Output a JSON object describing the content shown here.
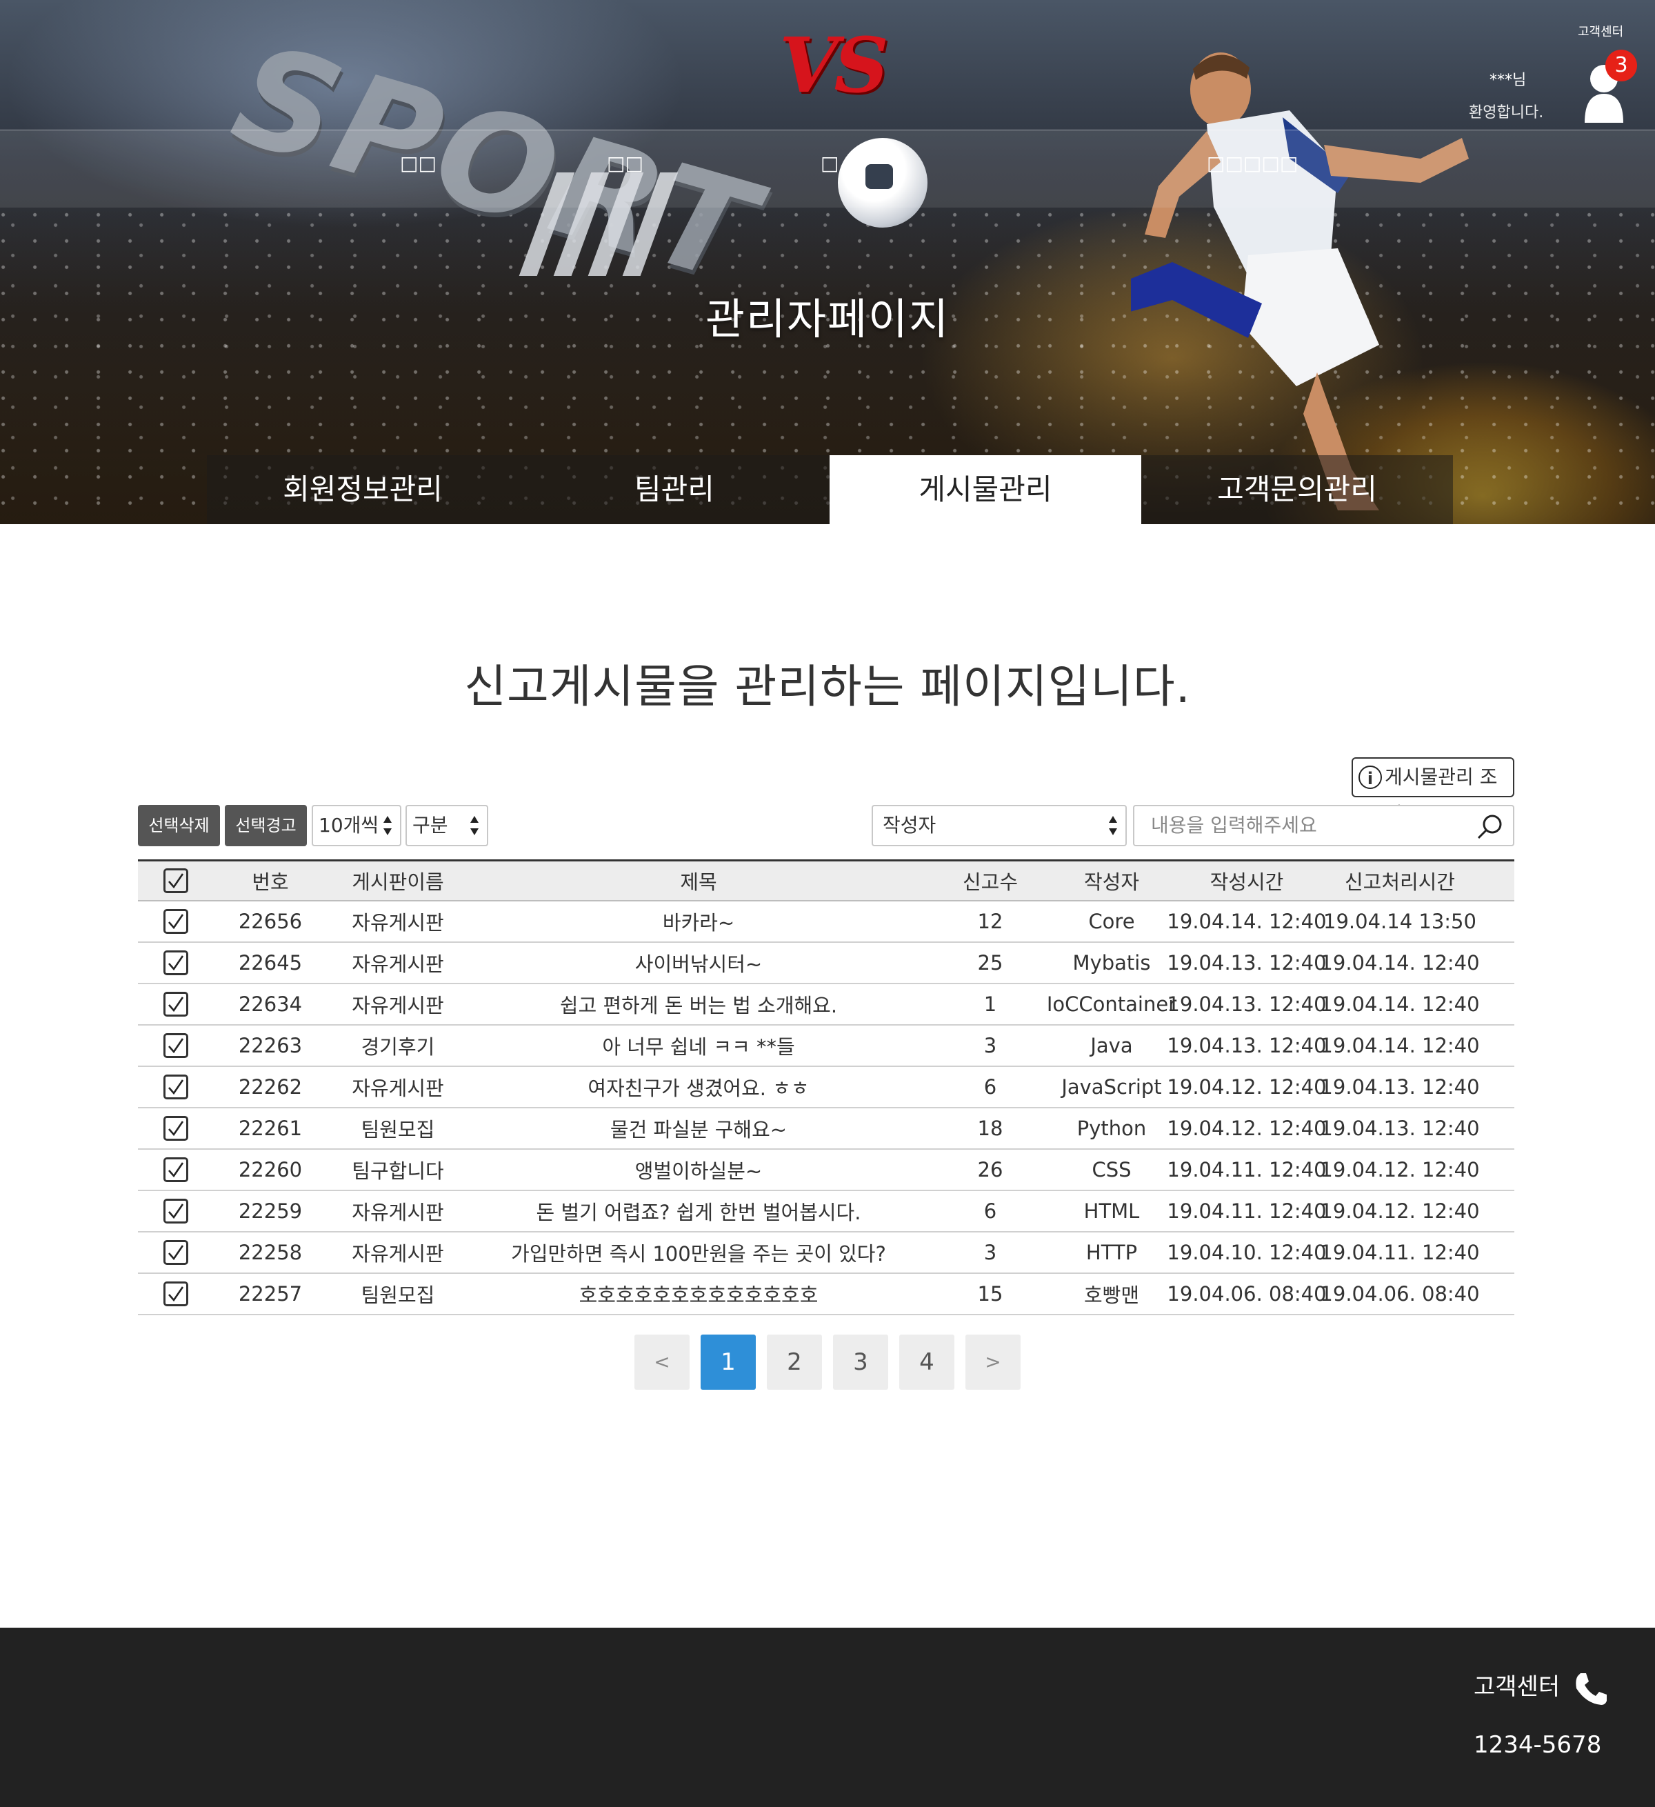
{
  "header": {
    "logo_text": "VS",
    "hero_graphic_text": "SPORT",
    "customer_center": "고객센터",
    "user_name": "***님",
    "welcome": "환영합니다.",
    "notification_count": "3",
    "nav": [
      "□□",
      "□□",
      "□",
      "□□□□□"
    ],
    "page_title": "관리자페이지"
  },
  "tabs": [
    {
      "label": "회원정보관리",
      "active": false
    },
    {
      "label": "팀관리",
      "active": false
    },
    {
      "label": "게시물관리",
      "active": true
    },
    {
      "label": "고객문의관리",
      "active": false
    }
  ],
  "main": {
    "heading": "신고게시물을 관리하는 페이지입니다.",
    "info_button": "게시물관리 조회",
    "delete_button": "선택삭제",
    "warn_button": "선택경고",
    "page_size_select": "10개씩",
    "category_select": "구분",
    "search_field_select": "작성자",
    "search_placeholder": "내용을 입력해주세요"
  },
  "table": {
    "columns": [
      "번호",
      "게시판이름",
      "제목",
      "신고수",
      "작성자",
      "작성시간",
      "신고처리시간"
    ],
    "rows": [
      {
        "no": "22656",
        "board": "자유게시판",
        "title": "바카라~",
        "reports": "12",
        "author": "Core",
        "written": "19.04.14. 12:40",
        "processed": "19.04.14 13:50"
      },
      {
        "no": "22645",
        "board": "자유게시판",
        "title": "사이버낚시터~",
        "reports": "25",
        "author": "Mybatis",
        "written": "19.04.13. 12:40",
        "processed": "19.04.14. 12:40"
      },
      {
        "no": "22634",
        "board": "자유게시판",
        "title": "쉽고 편하게 돈 버는 법 소개해요.",
        "reports": "1",
        "author": "IoCContainer",
        "written": "19.04.13. 12:40",
        "processed": "19.04.14. 12:40"
      },
      {
        "no": "22263",
        "board": "경기후기",
        "title": "아 너무 쉽네 ㅋㅋ **들",
        "reports": "3",
        "author": "Java",
        "written": "19.04.13. 12:40",
        "processed": "19.04.14. 12:40"
      },
      {
        "no": "22262",
        "board": "자유게시판",
        "title": "여자친구가 생겼어요. ㅎㅎ",
        "reports": "6",
        "author": "JavaScript",
        "written": "19.04.12. 12:40",
        "processed": "19.04.13. 12:40"
      },
      {
        "no": "22261",
        "board": "팀원모집",
        "title": "물건 파실분 구해요~",
        "reports": "18",
        "author": "Python",
        "written": "19.04.12. 12:40",
        "processed": "19.04.13. 12:40"
      },
      {
        "no": "22260",
        "board": "팀구합니다",
        "title": "앵벌이하실분~",
        "reports": "26",
        "author": "CSS",
        "written": "19.04.11. 12:40",
        "processed": "19.04.12. 12:40"
      },
      {
        "no": "22259",
        "board": "자유게시판",
        "title": "돈 벌기 어렵죠? 쉽게 한번 벌어봅시다.",
        "reports": "6",
        "author": "HTML",
        "written": "19.04.11. 12:40",
        "processed": "19.04.12. 12:40"
      },
      {
        "no": "22258",
        "board": "자유게시판",
        "title": "가입만하면 즉시 100만원을 주는 곳이 있다?",
        "reports": "3",
        "author": "HTTP",
        "written": "19.04.10. 12:40",
        "processed": "19.04.11. 12:40"
      },
      {
        "no": "22257",
        "board": "팀원모집",
        "title": "호호호호호호호호호호호호호",
        "reports": "15",
        "author": "호빵맨",
        "written": "19.04.06. 08:40",
        "processed": "19.04.06. 08:40"
      }
    ]
  },
  "pagination": {
    "prev": "<",
    "pages": [
      "1",
      "2",
      "3",
      "4"
    ],
    "current": "1",
    "next": ">"
  },
  "footer": {
    "label": "고객센터",
    "phone": "1234-5678"
  },
  "colors": {
    "logo_red": "#d6141c",
    "badge_red": "#e62117",
    "active_page_blue": "#2e8fd8",
    "footer_bg": "#222222",
    "dark_button": "#555555"
  }
}
